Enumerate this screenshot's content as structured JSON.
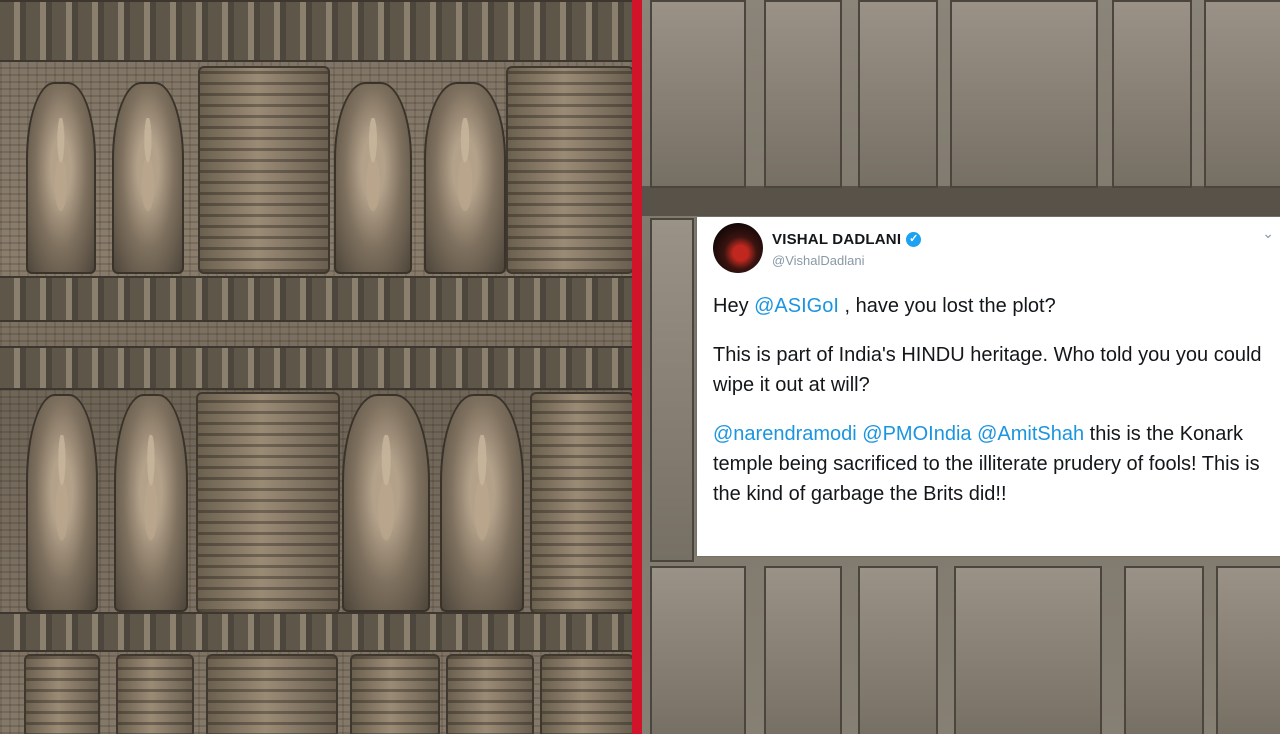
{
  "colors": {
    "divider": "#d2142a",
    "mention": "#1b95e0",
    "verified": "#1da1f2"
  },
  "tweet": {
    "display_name": "VISHAL DADLANI",
    "handle": "@VishalDadlani",
    "verified_icon": "verified-badge-icon",
    "menu_icon": "chevron-down-icon",
    "line1": {
      "pre": "Hey ",
      "mention": "@ASIGoI",
      "post": " , have you lost the plot?"
    },
    "line2": "This is part of India's HINDU heritage. Who told you you could wipe it out at will?",
    "line3": {
      "mention1": "@narendramodi",
      "mention2": "@PMOIndia",
      "mention3": "@AmitShah",
      "text": " this is the Konark temple being sacrificed to the illiterate prudery of fools! This is the kind of garbage the Brits did!!"
    }
  }
}
